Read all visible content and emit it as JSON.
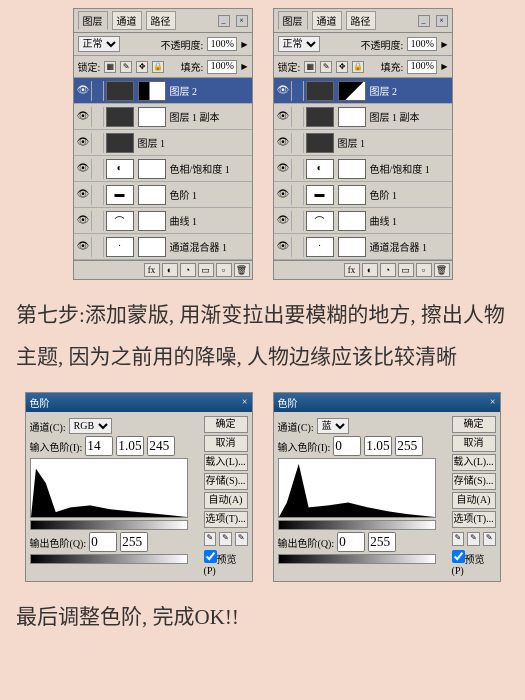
{
  "layersPanel": {
    "tabs": [
      "图层",
      "通道",
      "路径"
    ],
    "activeTab": 0,
    "mode": "正常",
    "opacityLabel": "不透明度:",
    "opacity": "100%",
    "lockLabel": "锁定:",
    "fillLabel": "填充:",
    "fill": "100%",
    "layers": [
      {
        "name": "图层 2",
        "selected": true,
        "hasMask": true
      },
      {
        "name": "图层 1 副本",
        "hasMask": true
      },
      {
        "name": "图层 1"
      },
      {
        "name": "色相/饱和度 1",
        "adj": "◐"
      },
      {
        "name": "色阶 1",
        "adj": "▬"
      },
      {
        "name": "曲线 1",
        "adj": "⌒"
      },
      {
        "name": "通道混合器 1",
        "adj": "·"
      }
    ]
  },
  "step7": "第七步:添加蒙版, 用渐变拉出要模糊的地方, 擦出人物主题, 因为之前用的降噪, 人物边缘应该比较清晰",
  "levels": {
    "title": "色阶",
    "channelLabel": "通道(C):",
    "channels": [
      "RGB",
      "蓝"
    ],
    "inputLabel": "输入色阶(I):",
    "outputLabel": "输出色阶(Q):",
    "left": {
      "in": [
        "14",
        "1.05",
        "245"
      ],
      "out": [
        "0",
        "255"
      ]
    },
    "right": {
      "in": [
        "0",
        "1.05",
        "255"
      ],
      "out": [
        "0",
        "255"
      ]
    },
    "buttons": [
      "确定",
      "取消",
      "载入(L)...",
      "存储(S)...",
      "自动(A)",
      "选项(T)..."
    ],
    "preview": "预览(P)"
  },
  "final": "最后调整色阶, 完成OK!!"
}
